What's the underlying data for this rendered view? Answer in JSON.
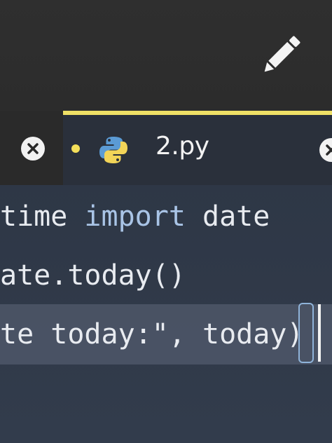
{
  "tabs": {
    "active": {
      "label": "2.py",
      "modified": true,
      "icon": "python-file-icon"
    }
  },
  "editor": {
    "lines": [
      {
        "text_a": "time ",
        "keyword": "import",
        "text_b": " date"
      },
      {
        "text": "ate.today()"
      },
      {
        "text": "te today:\", today)"
      }
    ]
  },
  "colors": {
    "active_tab_accent": "#efe066",
    "modified_dot": "#f4df5a",
    "keyword": "#a9c4e6",
    "code_text": "#e8ebf0"
  }
}
